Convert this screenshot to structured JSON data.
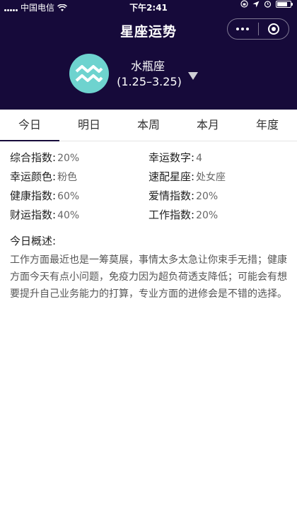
{
  "status_bar": {
    "carrier": "中国电信",
    "time": "下午2:41"
  },
  "nav": {
    "title": "星座运势",
    "more_icon": "more-dots-icon",
    "close_icon": "target-icon"
  },
  "sign": {
    "icon": "aquarius-icon",
    "icon_bg": "#6ed3cf",
    "name": "水瓶座",
    "date_range": "(1.25–3.25)"
  },
  "tabs": [
    {
      "label": "今日",
      "active": true
    },
    {
      "label": "明日",
      "active": false
    },
    {
      "label": "本周",
      "active": false
    },
    {
      "label": "本月",
      "active": false
    },
    {
      "label": "年度",
      "active": false
    }
  ],
  "stats": [
    {
      "label": "综合指数:",
      "value": "20%"
    },
    {
      "label": "幸运数字:",
      "value": "4"
    },
    {
      "label": "幸运颜色:",
      "value": "粉色"
    },
    {
      "label": "速配星座:",
      "value": "处女座"
    },
    {
      "label": "健康指数:",
      "value": "60%"
    },
    {
      "label": "爱情指数:",
      "value": "20%"
    },
    {
      "label": "财运指数:",
      "value": "40%"
    },
    {
      "label": "工作指数:",
      "value": "20%"
    }
  ],
  "summary": {
    "title": "今日概述:",
    "text": "工作方面最近也是一筹莫展，事情太多太急让你束手无措；健康方面今天有点小问题，免疫力因为超负荷透支降低；可能会有想要提升自己业务能力的打算，专业方面的进修会是不错的选择。"
  },
  "colors": {
    "header_bg": "#160a3a",
    "accent": "#6ed3cf"
  }
}
